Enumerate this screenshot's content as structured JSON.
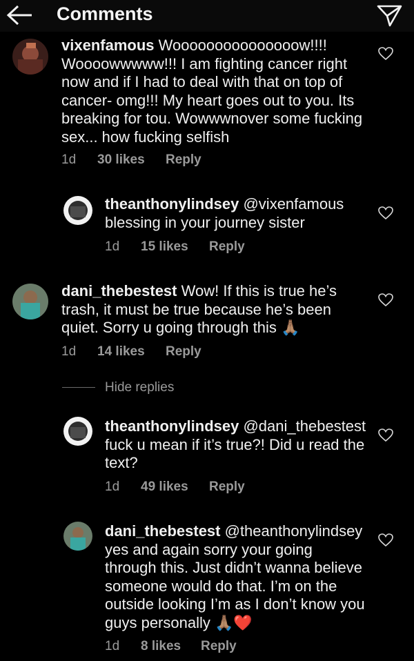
{
  "header": {
    "title": "Comments",
    "back_icon": "arrow-left-icon",
    "send_icon": "paper-plane-icon"
  },
  "comments": [
    {
      "username": "vixenfamous",
      "text": " Wooooooooooooooow!!!! Woooowwwww!!! I am fighting cancer right now and if I had to deal with that on top of cancer- omg!!! My heart goes out to you. Its breaking for tou. Wowwwnover some fucking sex... how fucking selfish",
      "time": "1d",
      "likes": "30 likes",
      "reply": "Reply"
    },
    {
      "username": "theanthonylindsey",
      "text": " @vixenfamous blessing in your journey sister",
      "time": "1d",
      "likes": "15 likes",
      "reply": "Reply"
    },
    {
      "username": "dani_thebestest",
      "text": " Wow! If this is true he’s trash, it must be true because he’s been quiet. Sorry u going through this 🙏🏽",
      "time": "1d",
      "likes": "14 likes",
      "reply": "Reply"
    },
    {
      "username": "theanthonylindsey",
      "text": " @dani_thebestest fuck u mean if it’s true?! Did u read the text?",
      "time": "1d",
      "likes": "49 likes",
      "reply": "Reply"
    },
    {
      "username": "dani_thebestest",
      "text": " @theanthonylindsey yes and again sorry your going through this. Just didn’t wanna believe someone would do that. I’m on the outside looking I’m as I don’t know you guys personally 🙏🏽❤️",
      "time": "1d",
      "likes": "8 likes",
      "reply": "Reply"
    }
  ],
  "hide_replies": "Hide replies",
  "colors": {
    "background": "#000000",
    "text": "#f0f0f0",
    "muted": "#9a9a9a"
  }
}
